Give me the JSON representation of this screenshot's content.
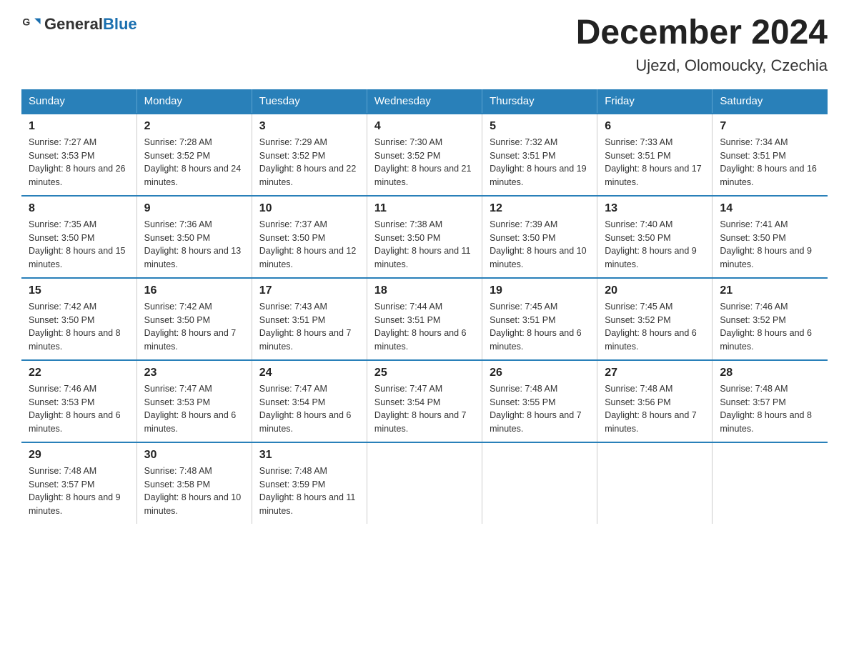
{
  "header": {
    "logo_general": "General",
    "logo_blue": "Blue",
    "month_title": "December 2024",
    "location": "Ujezd, Olomoucky, Czechia"
  },
  "days_of_week": [
    "Sunday",
    "Monday",
    "Tuesday",
    "Wednesday",
    "Thursday",
    "Friday",
    "Saturday"
  ],
  "weeks": [
    [
      {
        "day": "1",
        "sunrise": "7:27 AM",
        "sunset": "3:53 PM",
        "daylight": "8 hours and 26 minutes."
      },
      {
        "day": "2",
        "sunrise": "7:28 AM",
        "sunset": "3:52 PM",
        "daylight": "8 hours and 24 minutes."
      },
      {
        "day": "3",
        "sunrise": "7:29 AM",
        "sunset": "3:52 PM",
        "daylight": "8 hours and 22 minutes."
      },
      {
        "day": "4",
        "sunrise": "7:30 AM",
        "sunset": "3:52 PM",
        "daylight": "8 hours and 21 minutes."
      },
      {
        "day": "5",
        "sunrise": "7:32 AM",
        "sunset": "3:51 PM",
        "daylight": "8 hours and 19 minutes."
      },
      {
        "day": "6",
        "sunrise": "7:33 AM",
        "sunset": "3:51 PM",
        "daylight": "8 hours and 17 minutes."
      },
      {
        "day": "7",
        "sunrise": "7:34 AM",
        "sunset": "3:51 PM",
        "daylight": "8 hours and 16 minutes."
      }
    ],
    [
      {
        "day": "8",
        "sunrise": "7:35 AM",
        "sunset": "3:50 PM",
        "daylight": "8 hours and 15 minutes."
      },
      {
        "day": "9",
        "sunrise": "7:36 AM",
        "sunset": "3:50 PM",
        "daylight": "8 hours and 13 minutes."
      },
      {
        "day": "10",
        "sunrise": "7:37 AM",
        "sunset": "3:50 PM",
        "daylight": "8 hours and 12 minutes."
      },
      {
        "day": "11",
        "sunrise": "7:38 AM",
        "sunset": "3:50 PM",
        "daylight": "8 hours and 11 minutes."
      },
      {
        "day": "12",
        "sunrise": "7:39 AM",
        "sunset": "3:50 PM",
        "daylight": "8 hours and 10 minutes."
      },
      {
        "day": "13",
        "sunrise": "7:40 AM",
        "sunset": "3:50 PM",
        "daylight": "8 hours and 9 minutes."
      },
      {
        "day": "14",
        "sunrise": "7:41 AM",
        "sunset": "3:50 PM",
        "daylight": "8 hours and 9 minutes."
      }
    ],
    [
      {
        "day": "15",
        "sunrise": "7:42 AM",
        "sunset": "3:50 PM",
        "daylight": "8 hours and 8 minutes."
      },
      {
        "day": "16",
        "sunrise": "7:42 AM",
        "sunset": "3:50 PM",
        "daylight": "8 hours and 7 minutes."
      },
      {
        "day": "17",
        "sunrise": "7:43 AM",
        "sunset": "3:51 PM",
        "daylight": "8 hours and 7 minutes."
      },
      {
        "day": "18",
        "sunrise": "7:44 AM",
        "sunset": "3:51 PM",
        "daylight": "8 hours and 6 minutes."
      },
      {
        "day": "19",
        "sunrise": "7:45 AM",
        "sunset": "3:51 PM",
        "daylight": "8 hours and 6 minutes."
      },
      {
        "day": "20",
        "sunrise": "7:45 AM",
        "sunset": "3:52 PM",
        "daylight": "8 hours and 6 minutes."
      },
      {
        "day": "21",
        "sunrise": "7:46 AM",
        "sunset": "3:52 PM",
        "daylight": "8 hours and 6 minutes."
      }
    ],
    [
      {
        "day": "22",
        "sunrise": "7:46 AM",
        "sunset": "3:53 PM",
        "daylight": "8 hours and 6 minutes."
      },
      {
        "day": "23",
        "sunrise": "7:47 AM",
        "sunset": "3:53 PM",
        "daylight": "8 hours and 6 minutes."
      },
      {
        "day": "24",
        "sunrise": "7:47 AM",
        "sunset": "3:54 PM",
        "daylight": "8 hours and 6 minutes."
      },
      {
        "day": "25",
        "sunrise": "7:47 AM",
        "sunset": "3:54 PM",
        "daylight": "8 hours and 7 minutes."
      },
      {
        "day": "26",
        "sunrise": "7:48 AM",
        "sunset": "3:55 PM",
        "daylight": "8 hours and 7 minutes."
      },
      {
        "day": "27",
        "sunrise": "7:48 AM",
        "sunset": "3:56 PM",
        "daylight": "8 hours and 7 minutes."
      },
      {
        "day": "28",
        "sunrise": "7:48 AM",
        "sunset": "3:57 PM",
        "daylight": "8 hours and 8 minutes."
      }
    ],
    [
      {
        "day": "29",
        "sunrise": "7:48 AM",
        "sunset": "3:57 PM",
        "daylight": "8 hours and 9 minutes."
      },
      {
        "day": "30",
        "sunrise": "7:48 AM",
        "sunset": "3:58 PM",
        "daylight": "8 hours and 10 minutes."
      },
      {
        "day": "31",
        "sunrise": "7:48 AM",
        "sunset": "3:59 PM",
        "daylight": "8 hours and 11 minutes."
      },
      null,
      null,
      null,
      null
    ]
  ]
}
